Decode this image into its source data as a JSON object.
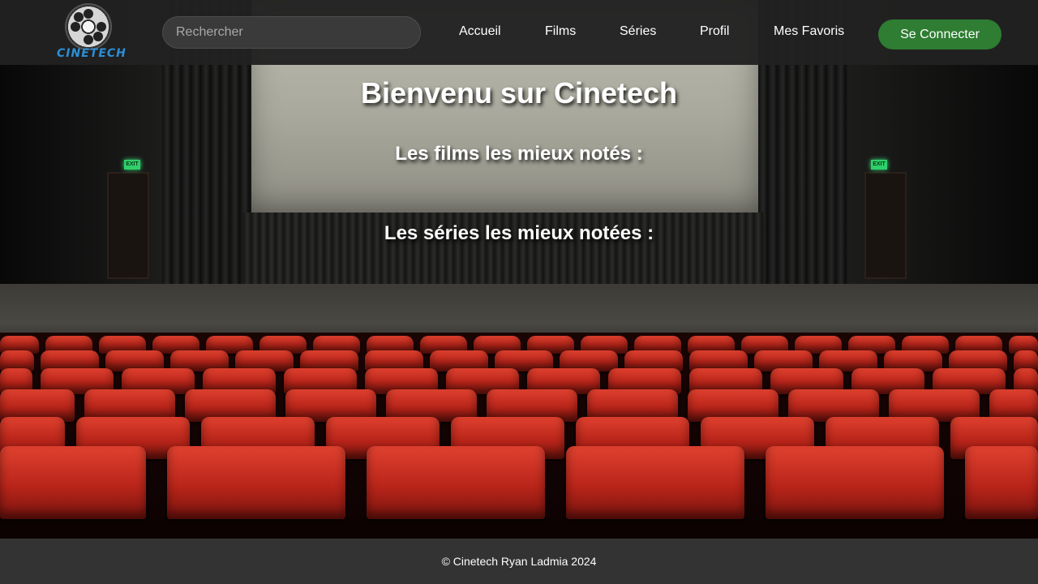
{
  "brand": {
    "name": "CINETECH",
    "logo_icon": "film-reel-icon",
    "accent": "#2b8fd6"
  },
  "header": {
    "search_placeholder": "Rechercher",
    "nav": [
      {
        "label": "Accueil"
      },
      {
        "label": "Films"
      },
      {
        "label": "Séries"
      },
      {
        "label": "Profil"
      },
      {
        "label": "Mes Favoris"
      }
    ],
    "login_label": "Se Connecter",
    "login_color": "#2e7d32"
  },
  "main": {
    "title": "Bienvenu sur Cinetech",
    "top_films_heading": "Les films les mieux notés :",
    "top_series_heading": "Les séries les mieux notées :"
  },
  "background": {
    "exit_sign": "EXIT"
  },
  "footer": {
    "text": "© Cinetech Ryan Ladmia 2024"
  }
}
